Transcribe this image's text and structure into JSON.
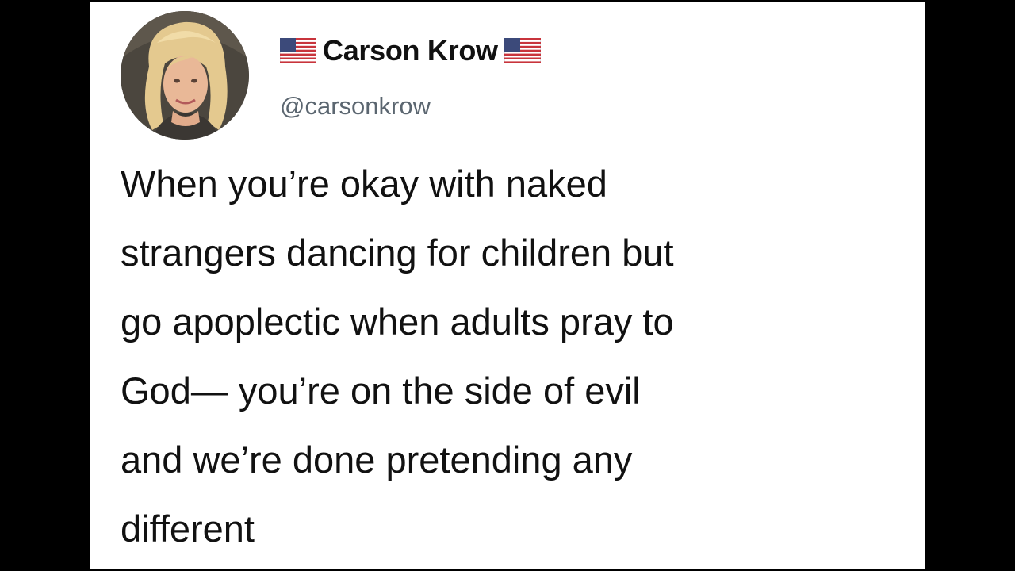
{
  "tweet": {
    "author": {
      "display_name": "Carson Krow",
      "handle": "@carsonkrow",
      "name_emoji": "us-flag-icon"
    },
    "text_lines": [
      "When you’re okay with naked",
      "strangers dancing for children but",
      "go apoplectic when adults pray to",
      "God— you’re on the side of evil",
      "and we’re done pretending any",
      "different"
    ]
  },
  "colors": {
    "background": "#000000",
    "card": "#ffffff",
    "text": "#111111",
    "handle": "#5b6670"
  }
}
